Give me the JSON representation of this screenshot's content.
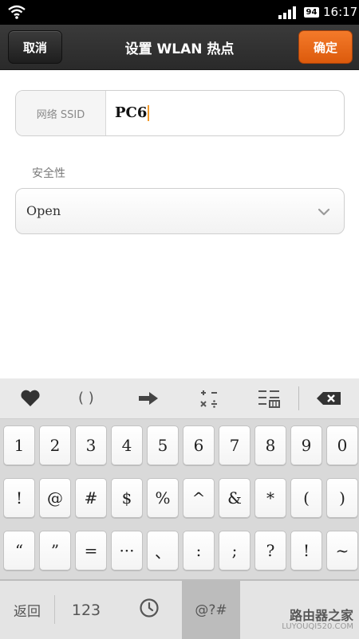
{
  "status_bar": {
    "time": "16:17",
    "battery": "94",
    "icons": [
      "wifi-icon",
      "signal-icon",
      "battery-icon"
    ]
  },
  "action_bar": {
    "title": "设置 WLAN 热点",
    "cancel_label": "取消",
    "ok_label": "确定",
    "accent_color": "#ec6a18"
  },
  "form": {
    "ssid_label": "网络 SSID",
    "ssid_value": "PC6",
    "security_label": "安全性",
    "security_value": "Open"
  },
  "keyboard": {
    "toolbar_icons": [
      "heart-icon",
      "brackets-icon",
      "arrow-right-icon",
      "math-symbols-icon",
      "format-icon",
      "backspace-icon"
    ],
    "toolbar_brackets": "( )",
    "toolbar_math": "+ −\n× ÷",
    "row1": [
      "1",
      "2",
      "3",
      "4",
      "5",
      "6",
      "7",
      "8",
      "9",
      "0"
    ],
    "row2": [
      "!",
      "@",
      "#",
      "$",
      "%",
      "^",
      "&",
      "*",
      "(",
      ")"
    ],
    "row3": [
      "“",
      "”",
      "=",
      "···",
      "、",
      ":",
      ";",
      "?",
      "!",
      "~"
    ],
    "bottom": {
      "back": "返回",
      "numbers": "123",
      "symbols": "@?#"
    }
  },
  "watermark": {
    "title": "路由器之家",
    "url": "LUYOUQI520.COM"
  }
}
